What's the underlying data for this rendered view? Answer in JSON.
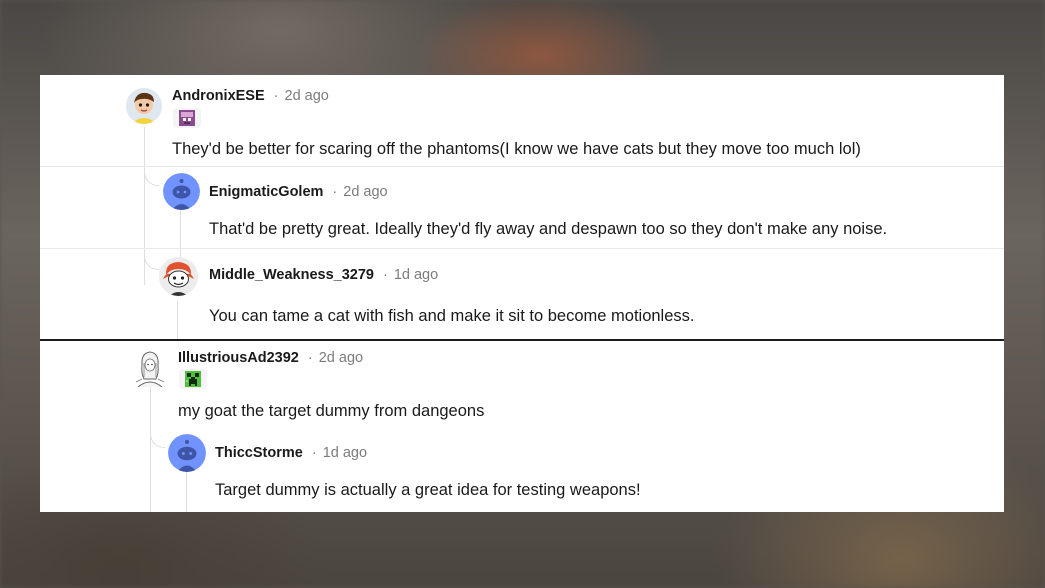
{
  "comments": [
    {
      "username": "AndronixESE",
      "time": "2d ago",
      "avatar": "cartoon-boy-avatar",
      "flair": "pink-block-flair",
      "text": "They'd be better for scaring off the phantoms(I know we have cats but they move too much lol)"
    },
    {
      "username": "EnigmaticGolem",
      "time": "2d ago",
      "avatar": "default-snoo-avatar",
      "text": "That'd be pretty great. Ideally they'd fly away and despawn too so they don't make any noise."
    },
    {
      "username": "Middle_Weakness_3279",
      "time": "1d ago",
      "avatar": "redhead-snoo-avatar",
      "text": "You can tame a cat with fish and make it sit to become motionless."
    },
    {
      "username": "IllustriousAd2392",
      "time": "2d ago",
      "avatar": "sketch-character-avatar",
      "flair": "creeper-flair",
      "text": "my goat the target dummy from dangeons"
    },
    {
      "username": "ThiccStorme",
      "time": "1d ago",
      "avatar": "default-snoo-avatar",
      "text": "Target dummy is actually a great idea for testing weapons!"
    }
  ],
  "separator": "·",
  "colors": {
    "snoo_blue": "#7193ff",
    "text": "#1a1a1b",
    "meta": "#7c7c7c"
  }
}
